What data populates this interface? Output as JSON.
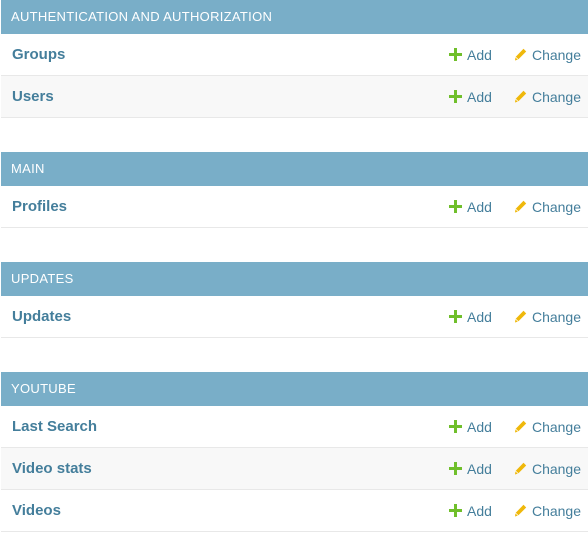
{
  "colors": {
    "caption_bg": "#79aec8",
    "link": "#447e9b",
    "add_icon": "#70bf2b",
    "change_icon": "#efb80b"
  },
  "actions": {
    "add_label": "Add",
    "change_label": "Change"
  },
  "modules": [
    {
      "caption": "Authentication and Authorization",
      "models": [
        {
          "name": "Groups"
        },
        {
          "name": "Users"
        }
      ]
    },
    {
      "caption": "Main",
      "models": [
        {
          "name": "Profiles"
        }
      ]
    },
    {
      "caption": "Updates",
      "models": [
        {
          "name": "Updates"
        }
      ]
    },
    {
      "caption": "Youtube",
      "models": [
        {
          "name": "Last Search"
        },
        {
          "name": "Video stats"
        },
        {
          "name": "Videos"
        }
      ]
    }
  ]
}
